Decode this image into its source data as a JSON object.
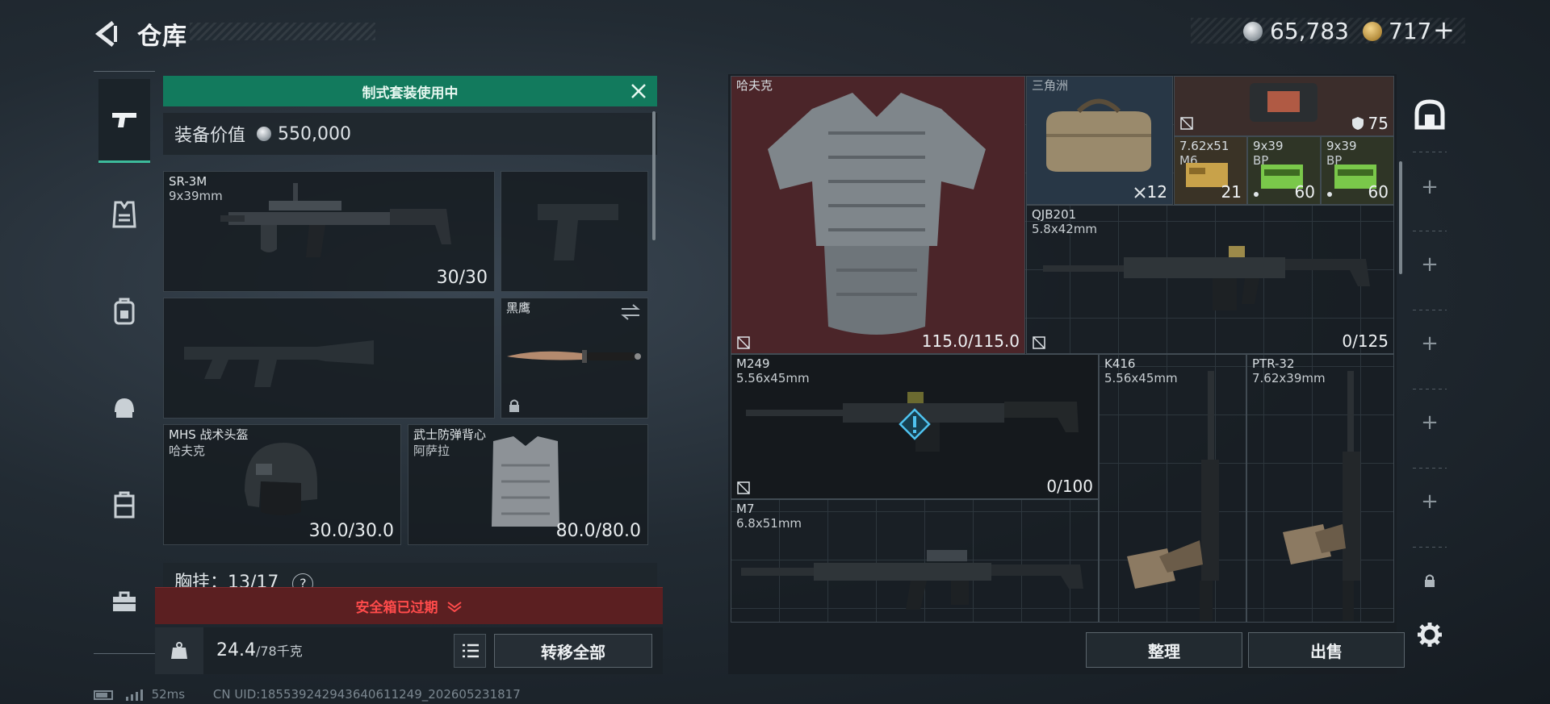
{
  "header": {
    "title": "仓库",
    "currency_silver": "65,783",
    "currency_gold": "717",
    "plus": "+"
  },
  "nav": {
    "items": [
      "weapon",
      "armor",
      "backpack",
      "helmet",
      "chest-rig",
      "toolbox"
    ]
  },
  "left_panel": {
    "banner": "制式套装使用中",
    "value_label": "装备价值",
    "value": "550,000",
    "primary_weapon": {
      "name": "SR-3M",
      "caliber": "9x39mm",
      "ammo": "30/30"
    },
    "melee": {
      "name": "黑鹰"
    },
    "helmet": {
      "name": "MHS 战术头盔",
      "brand": "哈夫克",
      "durability": "30.0/30.0"
    },
    "vest": {
      "name": "武士防弹背心",
      "brand": "阿萨拉",
      "durability": "80.0/80.0"
    },
    "chest_rig": {
      "label": "胸挂：",
      "value": "13/17",
      "help": "?"
    },
    "expired_text": "安全箱已过期",
    "weight": "24.4",
    "weight_max": "/78千克",
    "transfer_all": "转移全部"
  },
  "footer": {
    "ping": "52ms",
    "uid": "CN UID:185539242943640611249_202605231817"
  },
  "storage": {
    "armor": {
      "brand": "哈夫克",
      "durability": "115.0/115.0"
    },
    "bag": {
      "brand": "三角洲",
      "count": "12"
    },
    "case": {
      "count": "75"
    },
    "ammo1": {
      "name": "7.62x51",
      "sub": "M6",
      "count": "21"
    },
    "ammo2": {
      "name": "9x39",
      "sub": "BP",
      "count": "60"
    },
    "ammo3": {
      "name": "9x39",
      "sub": "BP",
      "count": "60"
    },
    "qjb": {
      "name": "QJB201",
      "caliber": "5.8x42mm",
      "ammo": "0/125"
    },
    "m249": {
      "name": "M249",
      "caliber": "5.56x45mm",
      "ammo": "0/100"
    },
    "k416": {
      "name": "K416",
      "caliber": "5.56x45mm"
    },
    "ptr": {
      "name": "PTR-32",
      "caliber": "7.62x39mm"
    },
    "m7": {
      "name": "M7",
      "caliber": "6.8x51mm"
    },
    "sort_btn": "整理",
    "sell_btn": "出售"
  },
  "colors": {
    "accent": "#127a5d",
    "danger": "#ff4b4b",
    "armor_bg": "#5a2a2e"
  }
}
